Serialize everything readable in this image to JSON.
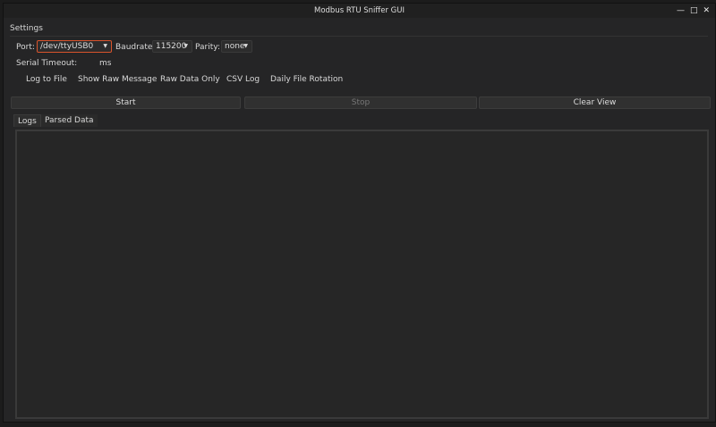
{
  "window": {
    "title": "Modbus RTU Sniffer GUI",
    "controls": [
      "minimize-icon",
      "maximize-icon",
      "close-icon"
    ]
  },
  "settings": {
    "group_label": "Settings",
    "port_label": "Port:",
    "port_value": "/dev/ttyUSB0",
    "baudrate_label": "Baudrate:",
    "baudrate_value": "115200",
    "parity_label": "Parity:",
    "parity_value": "none",
    "timeout_label": "Serial Timeout:",
    "timeout_value": "",
    "timeout_unit": "ms",
    "options": [
      "Log to File",
      "Show Raw Message",
      "Raw Data Only",
      "CSV Log",
      "Daily File Rotation"
    ]
  },
  "buttons": {
    "start": "Start",
    "stop": "Stop",
    "clear": "Clear View"
  },
  "tabs": [
    "Logs",
    "Parsed Data"
  ],
  "colors": {
    "focus_border": "#d9532c",
    "background": "#252526"
  }
}
